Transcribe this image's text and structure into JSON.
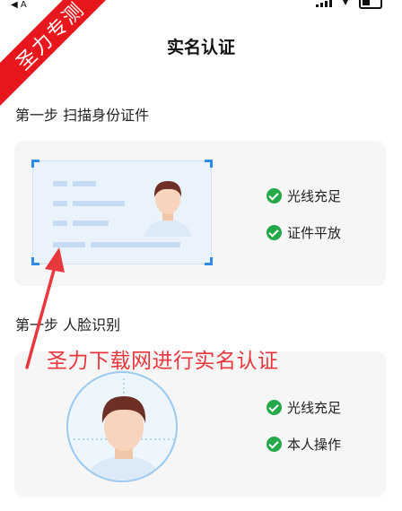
{
  "status_bar": {
    "back_label": "◀ A"
  },
  "watermark": {
    "text": "圣力专测"
  },
  "page": {
    "title": "实名认证"
  },
  "step1": {
    "title": "第一步 扫描身份证件",
    "checks": [
      "光线充足",
      "证件平放"
    ]
  },
  "step2": {
    "title": "第一步 人脸识别",
    "checks": [
      "光线充足",
      "本人操作"
    ]
  },
  "overlay": {
    "caption": "圣力下载网进行实名认证"
  },
  "colors": {
    "accent_blue": "#2e8be8",
    "check_green": "#25a84a",
    "watermark_red": "#e8171d",
    "caption_red": "#e8383d"
  }
}
